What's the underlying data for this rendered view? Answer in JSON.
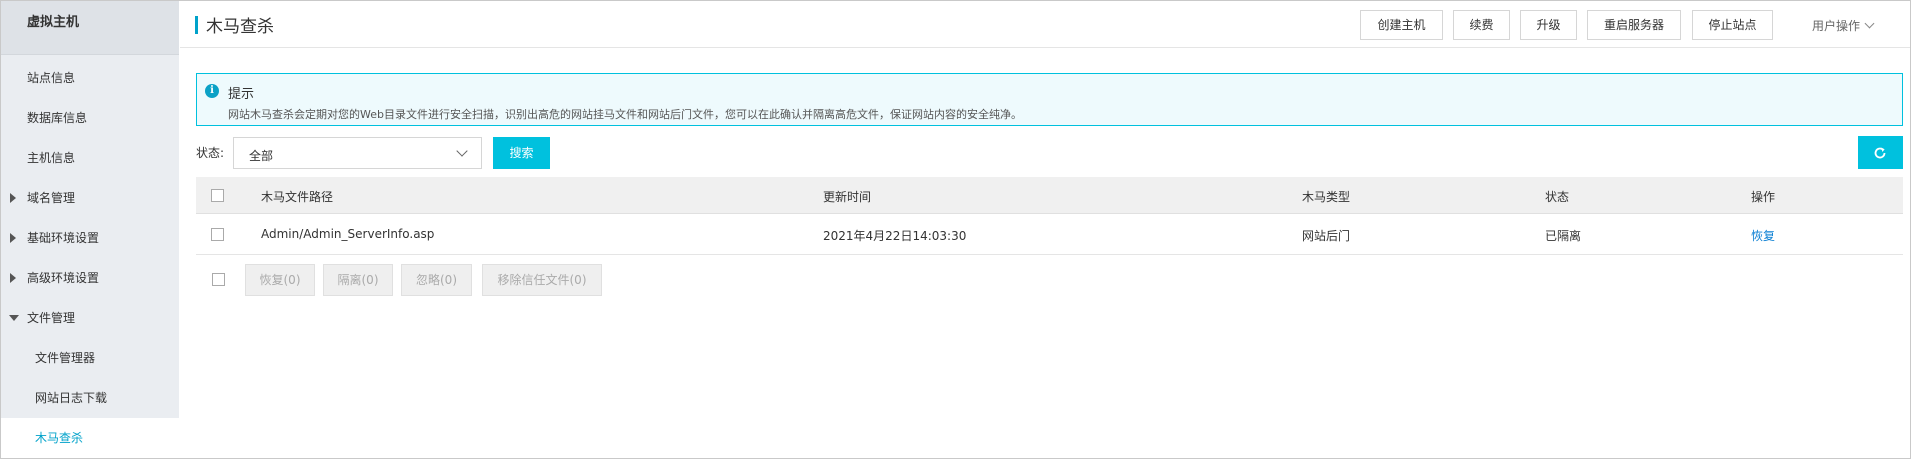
{
  "sidebar": {
    "title": "虚拟主机",
    "items": [
      {
        "label": "站点信息"
      },
      {
        "label": "数据库信息"
      },
      {
        "label": "主机信息"
      },
      {
        "label": "域名管理"
      },
      {
        "label": "基础环境设置"
      },
      {
        "label": "高级环境设置"
      },
      {
        "label": "文件管理"
      },
      {
        "label": "文件管理器"
      },
      {
        "label": "网站日志下载"
      },
      {
        "label": "木马查杀"
      }
    ]
  },
  "header": {
    "title": "木马查杀",
    "buttons": [
      "创建主机",
      "续费",
      "升级",
      "重启服务器",
      "停止站点"
    ],
    "user_ops": "用户操作"
  },
  "tip": {
    "icon_glyph": "i",
    "title": "提示",
    "text": "网站木马查杀会定期对您的Web目录文件进行安全扫描，识别出高危的网站挂马文件和网站后门文件，您可以在此确认并隔离高危文件，保证网站内容的安全纯净。"
  },
  "filter": {
    "label": "状态:",
    "selected": "全部",
    "search_label": "搜索"
  },
  "table": {
    "headers": [
      "木马文件路径",
      "更新时间",
      "木马类型",
      "状态",
      "操作"
    ],
    "rows": [
      {
        "path": "Admin/Admin_ServerInfo.asp",
        "time": "2021年4月22日14:03:30",
        "type": "网站后门",
        "status": "已隔离",
        "action": "恢复"
      }
    ]
  },
  "batch": {
    "buttons": [
      "恢复(0)",
      "隔离(0)",
      "忽略(0)",
      "移除信任文件(0)"
    ]
  },
  "colors": {
    "accent": "#00c1de",
    "link": "#0b7fd3",
    "active_nav": "#00a2ca"
  }
}
